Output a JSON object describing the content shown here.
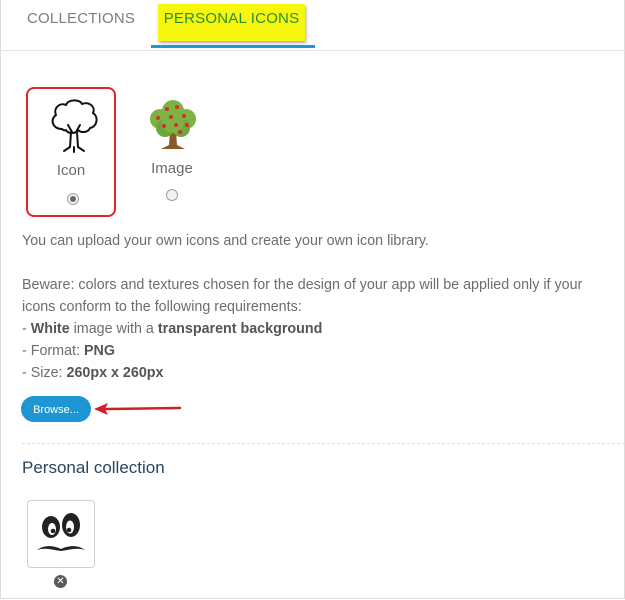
{
  "tabs": [
    {
      "label": "COLLECTIONS"
    },
    {
      "label": "PERSONAL ICONS"
    }
  ],
  "choices": {
    "icon": {
      "label": "Icon",
      "selected": true
    },
    "image": {
      "label": "Image",
      "selected": false
    }
  },
  "info": {
    "intro": "You can upload your own icons and create your own icon library.",
    "beware_1": "Beware: colors and textures chosen for the design of your app will be applied only if your",
    "beware_2": "icons conform to the following requirements:",
    "req1_prefix": "- ",
    "req1_bold1": "White",
    "req1_mid": " image with a ",
    "req1_bold2": "transparent background",
    "req2_prefix": "- Format: ",
    "req2_bold": "PNG",
    "req3_prefix": "- Size: ",
    "req3_bold": "260px x 260px"
  },
  "browse_label": "Browse...",
  "section_title": "Personal collection",
  "remove_glyph": "✕",
  "colors": {
    "accent": "#1e96d3",
    "highlight": "#f6f60e",
    "selection_border": "#e0252e",
    "title": "#28465c"
  }
}
